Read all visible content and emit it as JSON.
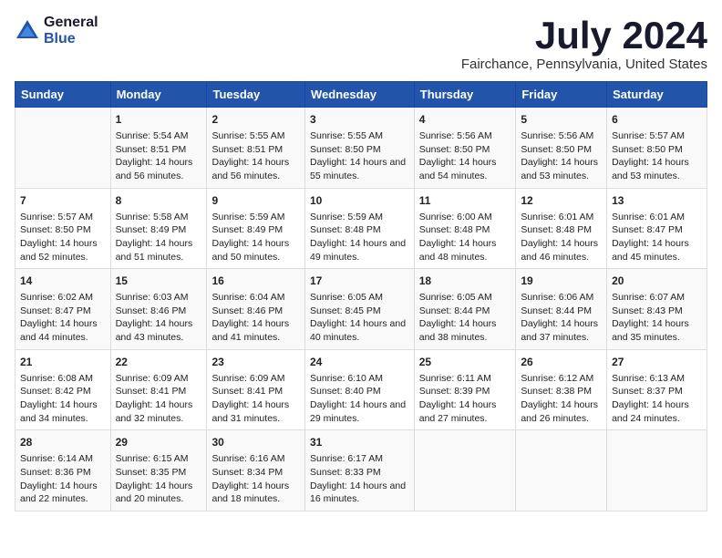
{
  "logo": {
    "general": "General",
    "blue": "Blue"
  },
  "title": "July 2024",
  "subtitle": "Fairchance, Pennsylvania, United States",
  "days_of_week": [
    "Sunday",
    "Monday",
    "Tuesday",
    "Wednesday",
    "Thursday",
    "Friday",
    "Saturday"
  ],
  "weeks": [
    [
      {
        "day": "",
        "content": ""
      },
      {
        "day": "1",
        "sunrise": "Sunrise: 5:54 AM",
        "sunset": "Sunset: 8:51 PM",
        "daylight": "Daylight: 14 hours and 56 minutes."
      },
      {
        "day": "2",
        "sunrise": "Sunrise: 5:55 AM",
        "sunset": "Sunset: 8:51 PM",
        "daylight": "Daylight: 14 hours and 56 minutes."
      },
      {
        "day": "3",
        "sunrise": "Sunrise: 5:55 AM",
        "sunset": "Sunset: 8:50 PM",
        "daylight": "Daylight: 14 hours and 55 minutes."
      },
      {
        "day": "4",
        "sunrise": "Sunrise: 5:56 AM",
        "sunset": "Sunset: 8:50 PM",
        "daylight": "Daylight: 14 hours and 54 minutes."
      },
      {
        "day": "5",
        "sunrise": "Sunrise: 5:56 AM",
        "sunset": "Sunset: 8:50 PM",
        "daylight": "Daylight: 14 hours and 53 minutes."
      },
      {
        "day": "6",
        "sunrise": "Sunrise: 5:57 AM",
        "sunset": "Sunset: 8:50 PM",
        "daylight": "Daylight: 14 hours and 53 minutes."
      }
    ],
    [
      {
        "day": "7",
        "sunrise": "Sunrise: 5:57 AM",
        "sunset": "Sunset: 8:50 PM",
        "daylight": "Daylight: 14 hours and 52 minutes."
      },
      {
        "day": "8",
        "sunrise": "Sunrise: 5:58 AM",
        "sunset": "Sunset: 8:49 PM",
        "daylight": "Daylight: 14 hours and 51 minutes."
      },
      {
        "day": "9",
        "sunrise": "Sunrise: 5:59 AM",
        "sunset": "Sunset: 8:49 PM",
        "daylight": "Daylight: 14 hours and 50 minutes."
      },
      {
        "day": "10",
        "sunrise": "Sunrise: 5:59 AM",
        "sunset": "Sunset: 8:48 PM",
        "daylight": "Daylight: 14 hours and 49 minutes."
      },
      {
        "day": "11",
        "sunrise": "Sunrise: 6:00 AM",
        "sunset": "Sunset: 8:48 PM",
        "daylight": "Daylight: 14 hours and 48 minutes."
      },
      {
        "day": "12",
        "sunrise": "Sunrise: 6:01 AM",
        "sunset": "Sunset: 8:48 PM",
        "daylight": "Daylight: 14 hours and 46 minutes."
      },
      {
        "day": "13",
        "sunrise": "Sunrise: 6:01 AM",
        "sunset": "Sunset: 8:47 PM",
        "daylight": "Daylight: 14 hours and 45 minutes."
      }
    ],
    [
      {
        "day": "14",
        "sunrise": "Sunrise: 6:02 AM",
        "sunset": "Sunset: 8:47 PM",
        "daylight": "Daylight: 14 hours and 44 minutes."
      },
      {
        "day": "15",
        "sunrise": "Sunrise: 6:03 AM",
        "sunset": "Sunset: 8:46 PM",
        "daylight": "Daylight: 14 hours and 43 minutes."
      },
      {
        "day": "16",
        "sunrise": "Sunrise: 6:04 AM",
        "sunset": "Sunset: 8:46 PM",
        "daylight": "Daylight: 14 hours and 41 minutes."
      },
      {
        "day": "17",
        "sunrise": "Sunrise: 6:05 AM",
        "sunset": "Sunset: 8:45 PM",
        "daylight": "Daylight: 14 hours and 40 minutes."
      },
      {
        "day": "18",
        "sunrise": "Sunrise: 6:05 AM",
        "sunset": "Sunset: 8:44 PM",
        "daylight": "Daylight: 14 hours and 38 minutes."
      },
      {
        "day": "19",
        "sunrise": "Sunrise: 6:06 AM",
        "sunset": "Sunset: 8:44 PM",
        "daylight": "Daylight: 14 hours and 37 minutes."
      },
      {
        "day": "20",
        "sunrise": "Sunrise: 6:07 AM",
        "sunset": "Sunset: 8:43 PM",
        "daylight": "Daylight: 14 hours and 35 minutes."
      }
    ],
    [
      {
        "day": "21",
        "sunrise": "Sunrise: 6:08 AM",
        "sunset": "Sunset: 8:42 PM",
        "daylight": "Daylight: 14 hours and 34 minutes."
      },
      {
        "day": "22",
        "sunrise": "Sunrise: 6:09 AM",
        "sunset": "Sunset: 8:41 PM",
        "daylight": "Daylight: 14 hours and 32 minutes."
      },
      {
        "day": "23",
        "sunrise": "Sunrise: 6:09 AM",
        "sunset": "Sunset: 8:41 PM",
        "daylight": "Daylight: 14 hours and 31 minutes."
      },
      {
        "day": "24",
        "sunrise": "Sunrise: 6:10 AM",
        "sunset": "Sunset: 8:40 PM",
        "daylight": "Daylight: 14 hours and 29 minutes."
      },
      {
        "day": "25",
        "sunrise": "Sunrise: 6:11 AM",
        "sunset": "Sunset: 8:39 PM",
        "daylight": "Daylight: 14 hours and 27 minutes."
      },
      {
        "day": "26",
        "sunrise": "Sunrise: 6:12 AM",
        "sunset": "Sunset: 8:38 PM",
        "daylight": "Daylight: 14 hours and 26 minutes."
      },
      {
        "day": "27",
        "sunrise": "Sunrise: 6:13 AM",
        "sunset": "Sunset: 8:37 PM",
        "daylight": "Daylight: 14 hours and 24 minutes."
      }
    ],
    [
      {
        "day": "28",
        "sunrise": "Sunrise: 6:14 AM",
        "sunset": "Sunset: 8:36 PM",
        "daylight": "Daylight: 14 hours and 22 minutes."
      },
      {
        "day": "29",
        "sunrise": "Sunrise: 6:15 AM",
        "sunset": "Sunset: 8:35 PM",
        "daylight": "Daylight: 14 hours and 20 minutes."
      },
      {
        "day": "30",
        "sunrise": "Sunrise: 6:16 AM",
        "sunset": "Sunset: 8:34 PM",
        "daylight": "Daylight: 14 hours and 18 minutes."
      },
      {
        "day": "31",
        "sunrise": "Sunrise: 6:17 AM",
        "sunset": "Sunset: 8:33 PM",
        "daylight": "Daylight: 14 hours and 16 minutes."
      },
      {
        "day": "",
        "content": ""
      },
      {
        "day": "",
        "content": ""
      },
      {
        "day": "",
        "content": ""
      }
    ]
  ]
}
